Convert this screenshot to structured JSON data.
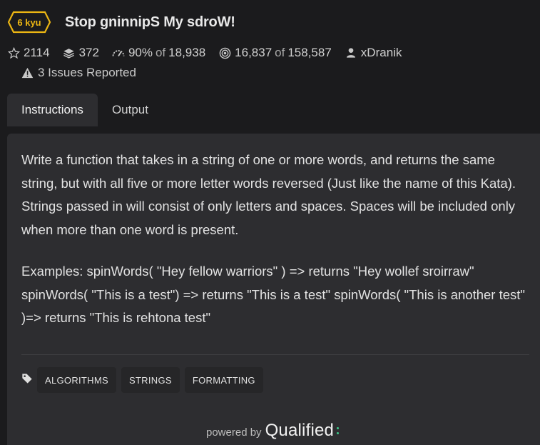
{
  "kata": {
    "rank": "6 kyu",
    "title": "Stop gninnipS My sdroW!",
    "rank_color": "#ecb613"
  },
  "stats": {
    "stars": "2114",
    "collections": "372",
    "satisfaction_percent": "90%",
    "satisfaction_of": "of",
    "satisfaction_votes": "18,938",
    "completed": "16,837",
    "completed_of": "of",
    "attempts": "158,587",
    "author": "xDranik"
  },
  "issues": {
    "label": "3 Issues Reported"
  },
  "tabs": [
    {
      "label": "Instructions",
      "active": true
    },
    {
      "label": "Output",
      "active": false
    }
  ],
  "description": {
    "paragraph1": "Write a function that takes in a string of one or more words, and returns the same string, but with all five or more letter words reversed (Just like the name of this Kata). Strings passed in will consist of only letters and spaces. Spaces will be included only when more than one word is present.",
    "paragraph2": "Examples: spinWords( \"Hey fellow warriors\" ) => returns \"Hey wollef sroirraw\" spinWords( \"This is a test\") => returns \"This is a test\" spinWords( \"This is another test\" )=> returns \"This is rehtona test\""
  },
  "tags": [
    "ALGORITHMS",
    "STRINGS",
    "FORMATTING"
  ],
  "footer": {
    "powered_by": "powered by",
    "brand": "Qualified",
    "brand_accent": "#3cc88a"
  },
  "icons": {
    "star": "star-icon",
    "collections": "stack-icon",
    "satisfaction": "gauge-icon",
    "completed": "target-icon",
    "author": "user-icon",
    "issues": "warning-icon",
    "tags": "tag-icon"
  }
}
